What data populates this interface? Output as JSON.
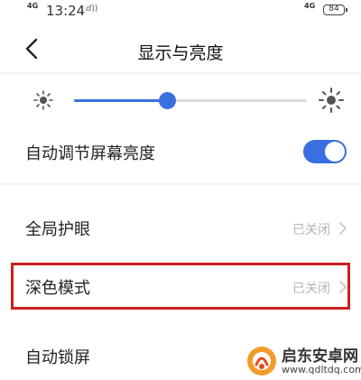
{
  "status_bar": {
    "network_left": "4G",
    "time": "13:24",
    "network_right": "4G",
    "battery": "84"
  },
  "header": {
    "back_icon": "chevron-left-icon",
    "title": "显示与亮度"
  },
  "brightness": {
    "min_icon": "sun-small-icon",
    "max_icon": "sun-large-icon",
    "level": 0.4,
    "accent": "#3a6fe0"
  },
  "auto_brightness": {
    "label": "自动调节屏幕亮度",
    "enabled": true
  },
  "settings": [
    {
      "label": "全局护眼",
      "value": "已关闭"
    },
    {
      "label": "深色模式",
      "value": "已关闭"
    },
    {
      "label": "自动锁屏"
    }
  ],
  "highlight_color": "#cc1f1f",
  "watermark": {
    "name": "启东安卓网",
    "url": "www.qdltdq.com"
  }
}
